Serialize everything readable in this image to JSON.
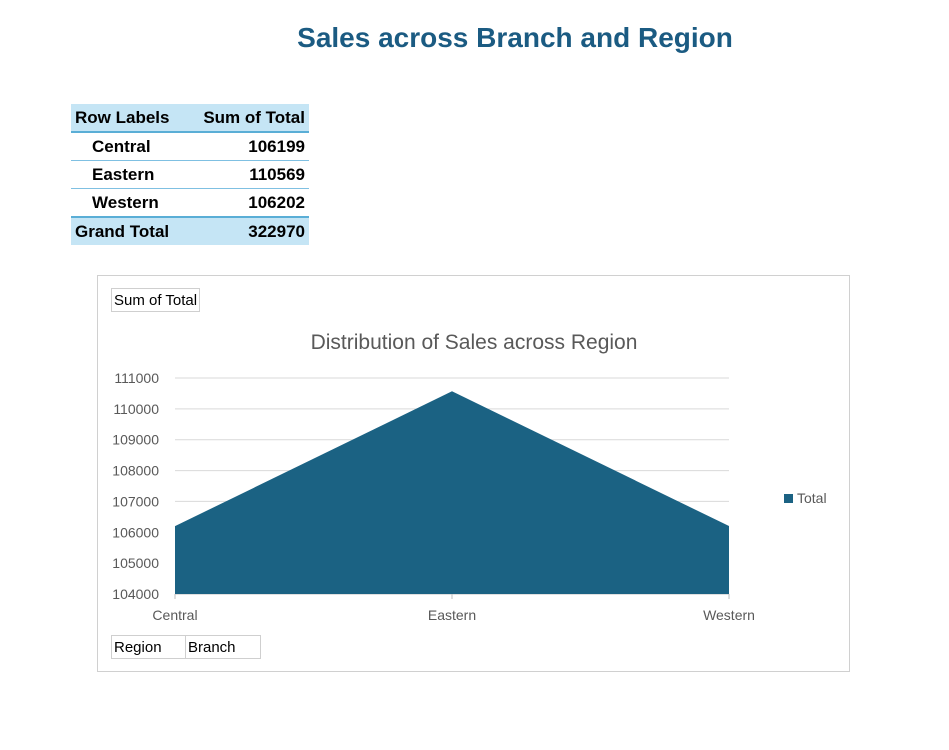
{
  "page": {
    "title": "Sales across Branch and Region"
  },
  "pivot": {
    "headers": [
      "Row Labels",
      "Sum of Total"
    ],
    "rows": [
      {
        "label": "Central",
        "value": "106199"
      },
      {
        "label": "Eastern",
        "value": "110569"
      },
      {
        "label": "Western",
        "value": "106202"
      }
    ],
    "total": {
      "label": "Grand Total",
      "value": "322970"
    }
  },
  "chart_buttons": {
    "value_field": "Sum of Total",
    "axis_fields": [
      "Region",
      "Branch"
    ]
  },
  "chart_data": {
    "type": "area",
    "title": "Distribution of Sales across Region",
    "categories": [
      "Central",
      "Eastern",
      "Western"
    ],
    "series": [
      {
        "name": "Total",
        "values": [
          106199,
          110569,
          106202
        ],
        "color": "#1b6283"
      }
    ],
    "ylim": [
      104000,
      111000
    ],
    "yticks": [
      "111000",
      "110000",
      "109000",
      "108000",
      "107000",
      "106000",
      "105000",
      "104000"
    ],
    "grid": true,
    "legend_position": "right"
  }
}
